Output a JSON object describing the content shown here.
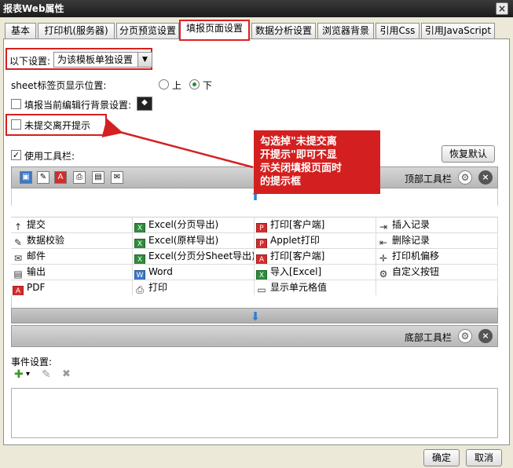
{
  "window": {
    "title": "报表Web属性",
    "close_glyph": "×"
  },
  "tabs": [
    {
      "label": "基本"
    },
    {
      "label": "打印机(服务器)"
    },
    {
      "label": "分页预览设置"
    },
    {
      "label": "填报页面设置",
      "active": true
    },
    {
      "label": "数据分析设置"
    },
    {
      "label": "浏览器背景"
    },
    {
      "label": "引用Css"
    },
    {
      "label": "引用JavaScript"
    }
  ],
  "settings": {
    "scope_label": "以下设置:",
    "scope_value": "为该模板单独设置",
    "sheet_tab_label": "sheet标签页显示位置:",
    "sheet_tab_options": [
      "上",
      "下"
    ],
    "sheet_tab_selected": "下",
    "bg_label": "填报当前编辑行背景设置:",
    "bg_checked": false,
    "unsubmitted_label": "未提交离开提示",
    "unsubmitted_checked": false,
    "use_toolbar_label": "使用工具栏:",
    "use_toolbar_checked": true,
    "restore_button": "恢复默认"
  },
  "toolbar": {
    "top_label": "顶部工具栏",
    "bottom_label": "底部工具栏",
    "top_icons": [
      "save-icon",
      "edit-icon",
      "pdf-icon",
      "print-icon",
      "doc-icon",
      "mail-icon"
    ]
  },
  "buttons_grid": [
    [
      {
        "label": "提交",
        "icon": "↑",
        "tone": "plain"
      },
      {
        "label": "Excel(分页导出)",
        "icon": "X",
        "tone": "green"
      },
      {
        "label": "打印[客户端]",
        "icon": "P",
        "tone": "red"
      },
      {
        "label": "插入记录",
        "icon": "⇥",
        "tone": "plain"
      }
    ],
    [
      {
        "label": "数据校验",
        "icon": "✎",
        "tone": "plain"
      },
      {
        "label": "Excel(原样导出)",
        "icon": "X",
        "tone": "green"
      },
      {
        "label": "Applet打印",
        "icon": "P",
        "tone": "red"
      },
      {
        "label": "删除记录",
        "icon": "⇤",
        "tone": "plain"
      }
    ],
    [
      {
        "label": "邮件",
        "icon": "✉",
        "tone": "plain"
      },
      {
        "label": "Excel(分页分Sheet导出)",
        "icon": "X",
        "tone": "green"
      },
      {
        "label": "打印[客户端]",
        "icon": "A",
        "tone": "red"
      },
      {
        "label": "打印机偏移",
        "icon": "✛",
        "tone": "plain"
      }
    ],
    [
      {
        "label": "输出",
        "icon": "▤",
        "tone": "plain"
      },
      {
        "label": "Word",
        "icon": "W",
        "tone": "blue"
      },
      {
        "label": "导入[Excel]",
        "icon": "X",
        "tone": "green"
      },
      {
        "label": "自定义按钮",
        "icon": "⚙",
        "tone": "plain"
      }
    ],
    [
      {
        "label": "PDF",
        "icon": "A",
        "tone": "red"
      },
      {
        "label": "打印",
        "icon": "⎙",
        "tone": "plain"
      },
      {
        "label": "显示单元格值",
        "icon": "▭",
        "tone": "plain"
      },
      {
        "label": "",
        "icon": "",
        "tone": "plain"
      }
    ]
  ],
  "events": {
    "label": "事件设置:",
    "add_glyph": "✚",
    "add_caret": "▾",
    "edit_glyph": "✎",
    "delete_glyph": "✖"
  },
  "callout": {
    "lines": [
      "勾选掉\"未提交离",
      "开提示\"即可不显",
      "示关闭填报页面时",
      "的提示框"
    ]
  },
  "footer": {
    "ok": "确定",
    "cancel": "取消"
  },
  "colors": {
    "annotation_red": "#d42020",
    "arrow_blue": "#2f7fd6"
  }
}
